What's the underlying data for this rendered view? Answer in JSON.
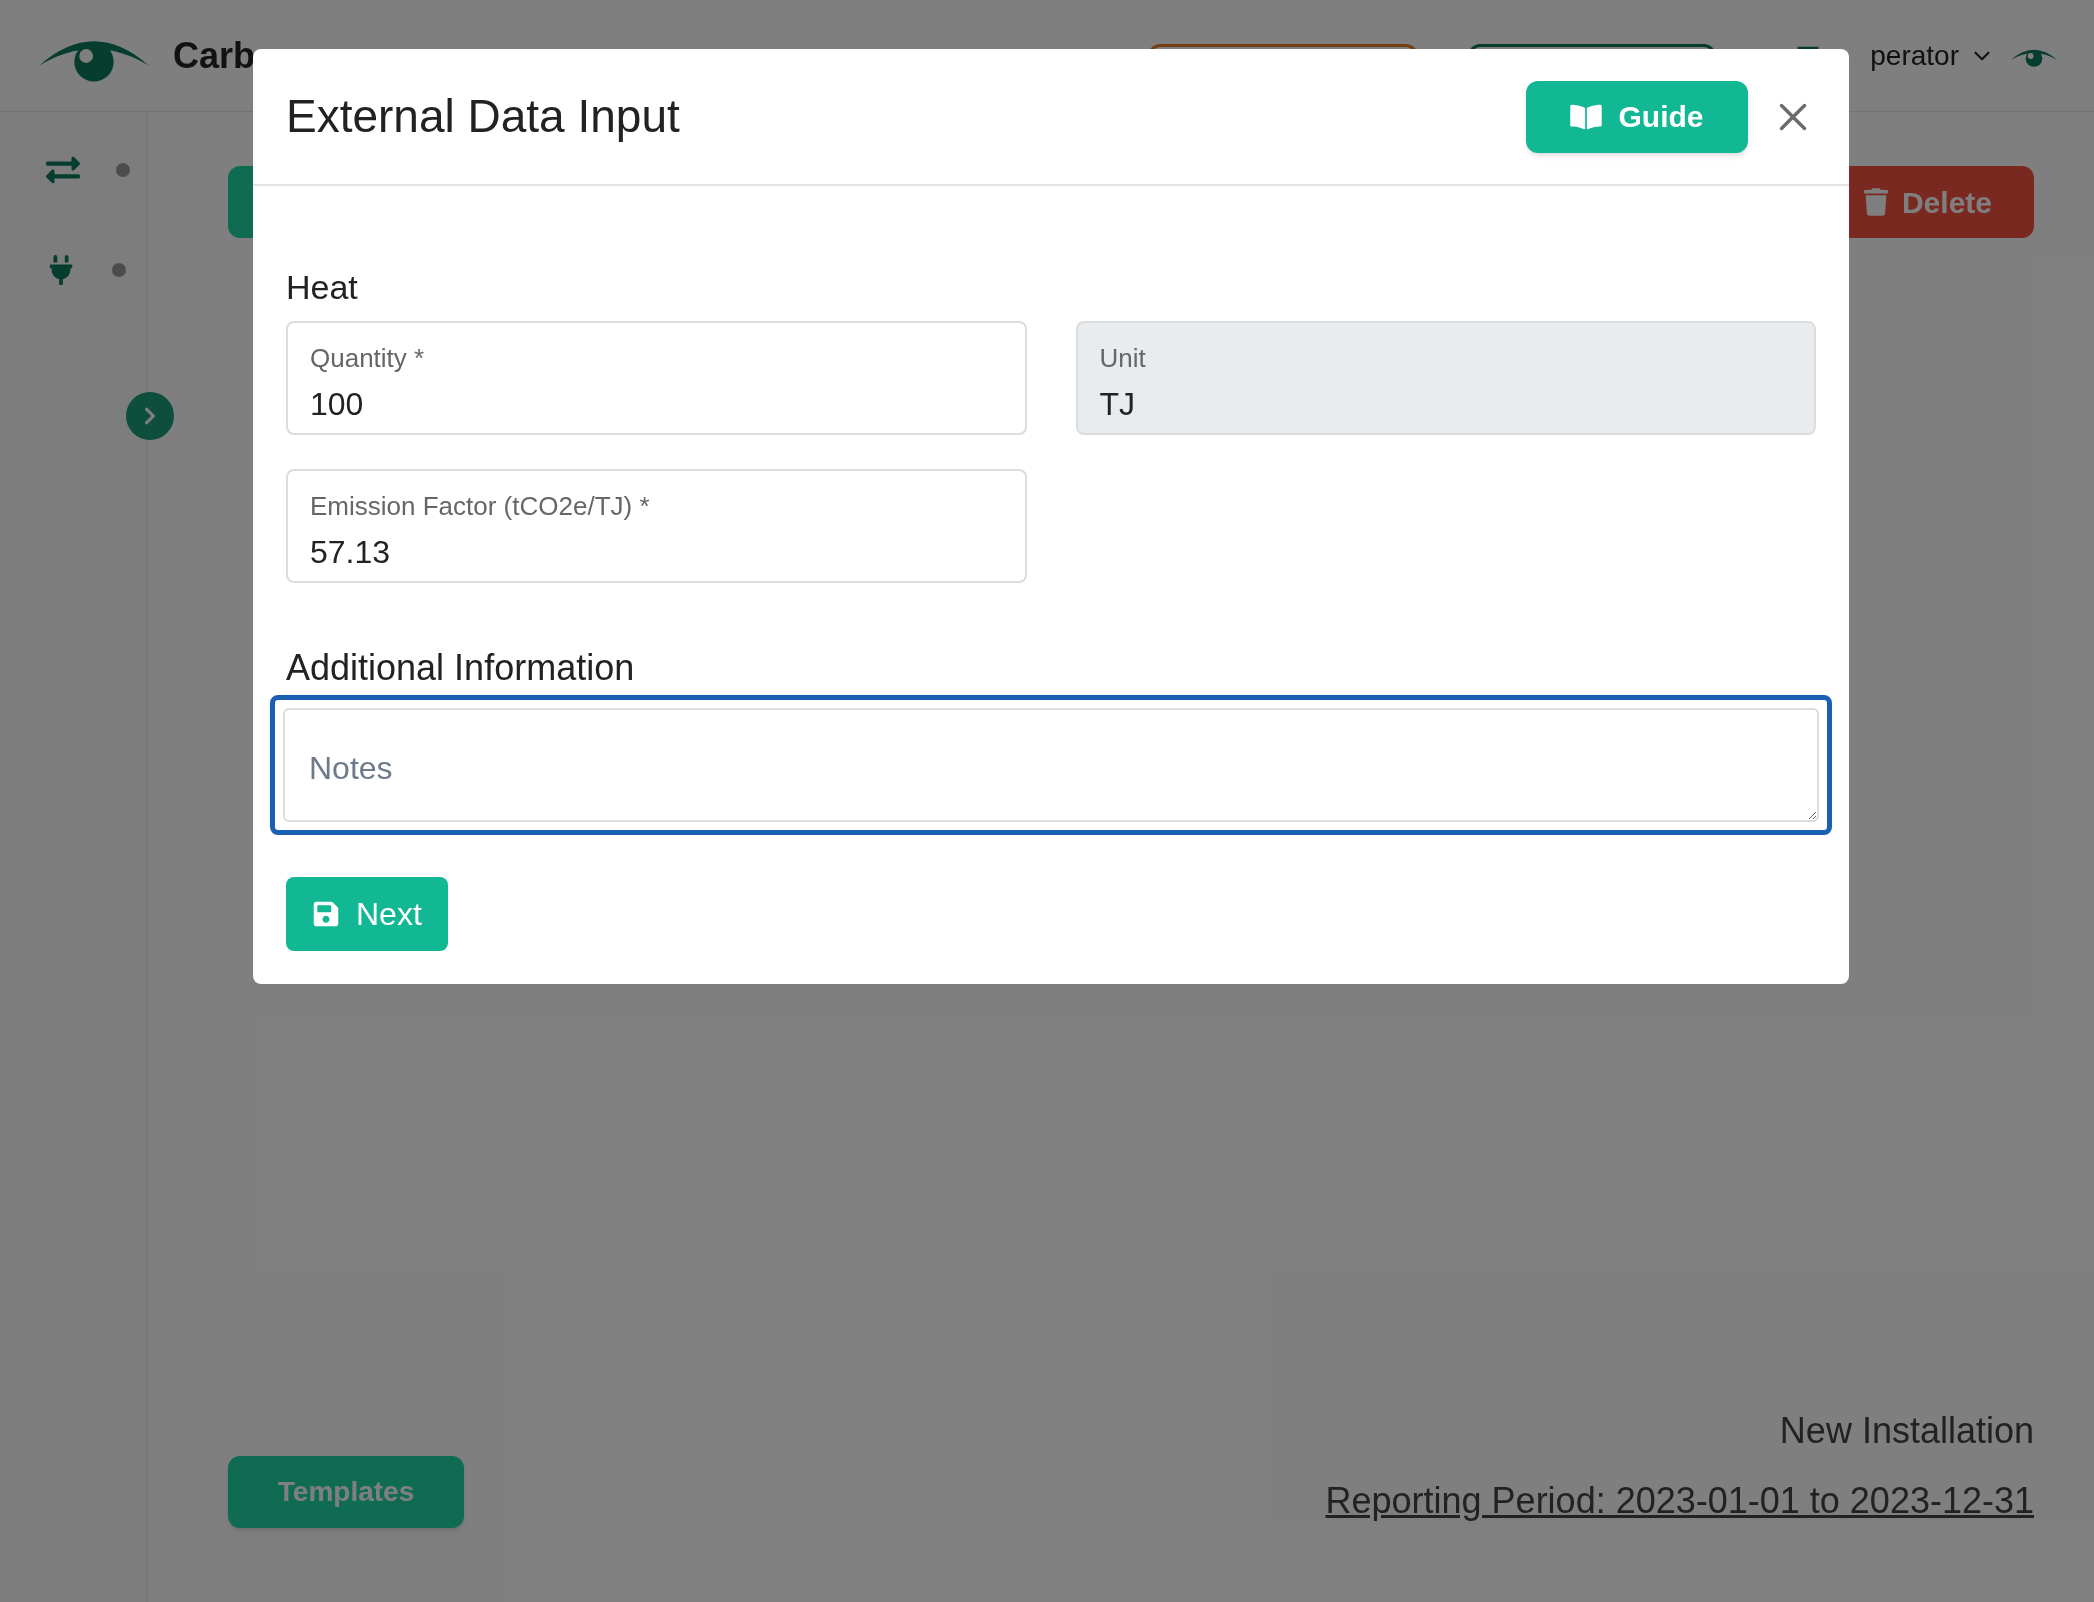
{
  "header": {
    "brand": "Carb",
    "user_menu": "perator"
  },
  "sidebar": {
    "items": [
      {
        "kind": "transfer"
      },
      {
        "kind": "plug"
      }
    ]
  },
  "toolbar": {
    "delete_button": "Delete"
  },
  "footer": {
    "templates_button": "Templates",
    "installation": "New Installation",
    "reporting_period": "Reporting Period: 2023-01-01 to 2023-12-31"
  },
  "modal": {
    "title": "External Data Input",
    "guide_button": "Guide",
    "section": "Heat",
    "fields": [
      {
        "label": "Quantity *",
        "value": "100",
        "disabled": false
      },
      {
        "label": "Unit",
        "value": "TJ",
        "disabled": true
      },
      {
        "label": "Emission Factor (tCO2e/TJ) *",
        "value": "57.13",
        "disabled": false
      }
    ],
    "notes_heading": "Additional Information",
    "notes": {
      "placeholder": "Notes",
      "focused": true
    },
    "next_button": "Next"
  }
}
